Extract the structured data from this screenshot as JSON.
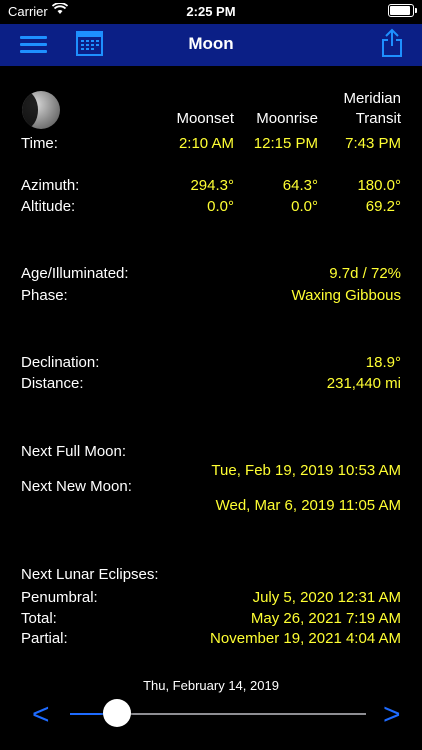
{
  "status": {
    "carrier": "Carrier",
    "time": "2:25 PM",
    "battery_level": 1.0
  },
  "nav": {
    "title": "Moon"
  },
  "columns": {
    "moonset": "Moonset",
    "moonrise": "Moonrise",
    "meridian1": "Meridian",
    "meridian2": "Transit"
  },
  "time": {
    "label": "Time:",
    "moonset": "2:10 AM",
    "moonrise": "12:15 PM",
    "transit": "7:43 PM"
  },
  "azimuth": {
    "label": "Azimuth:",
    "moonset": "294.3°",
    "moonrise": "64.3°",
    "transit": "180.0°"
  },
  "altitude": {
    "label": "Altitude:",
    "moonset": "0.0°",
    "moonrise": "0.0°",
    "transit": "69.2°"
  },
  "age": {
    "label": "Age/Illuminated:",
    "value": "9.7d / 72%"
  },
  "phase": {
    "label": "Phase:",
    "value": "Waxing Gibbous"
  },
  "declination": {
    "label": "Declination:",
    "value": "18.9°"
  },
  "distance": {
    "label": "Distance:",
    "value": "231,440 mi"
  },
  "full_moon": {
    "label": "Next Full Moon:",
    "value": "Tue, Feb 19, 2019 10:53 AM"
  },
  "new_moon": {
    "label": "Next New Moon:",
    "value": "Wed, Mar 6, 2019 11:05 AM"
  },
  "eclipses": {
    "label": "Next Lunar Eclipses:",
    "penumbral": {
      "label": "Penumbral:",
      "value": "July 5, 2020 12:31 AM"
    },
    "total": {
      "label": "Total:",
      "value": "May 26, 2021 7:19 AM"
    },
    "partial": {
      "label": "Partial:",
      "value": "November 19, 2021 4:04 AM"
    }
  },
  "footer": {
    "date": "Thu, February 14, 2019",
    "prev": "<",
    "next": ">",
    "slider_value": 0.16
  },
  "colors": {
    "nav_bar": "#0b1f86",
    "accent": "#1e6bff",
    "value_text": "#ffff33"
  },
  "icons": {
    "menu": "hamburger-menu-icon",
    "calendar": "calendar-icon",
    "share": "share-icon",
    "moon": "moon-phase-icon"
  }
}
